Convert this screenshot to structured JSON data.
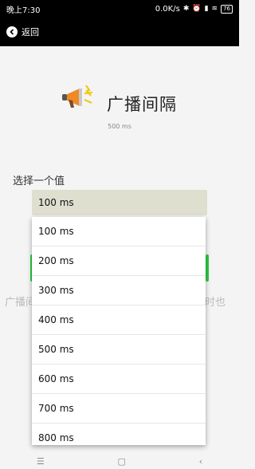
{
  "status_bar": {
    "time": "晚上7:30",
    "speed": "0.0K/s",
    "battery": "76"
  },
  "app_bar": {
    "back_label": "返回"
  },
  "hero": {
    "title": "广播间隔",
    "subtitle": "500 ms"
  },
  "select": {
    "label": "选择一个值",
    "current_value": "100 ms",
    "options": [
      "100 ms",
      "200 ms",
      "300 ms",
      "400 ms",
      "500 ms",
      "600 ms",
      "700 ms",
      "800 ms"
    ]
  },
  "background_text": {
    "left": "广播间",
    "right": "间时也"
  },
  "colors": {
    "accent_green": "#2ecc40",
    "selected_bg": "#dfdfd0",
    "bar_black": "#000000"
  }
}
